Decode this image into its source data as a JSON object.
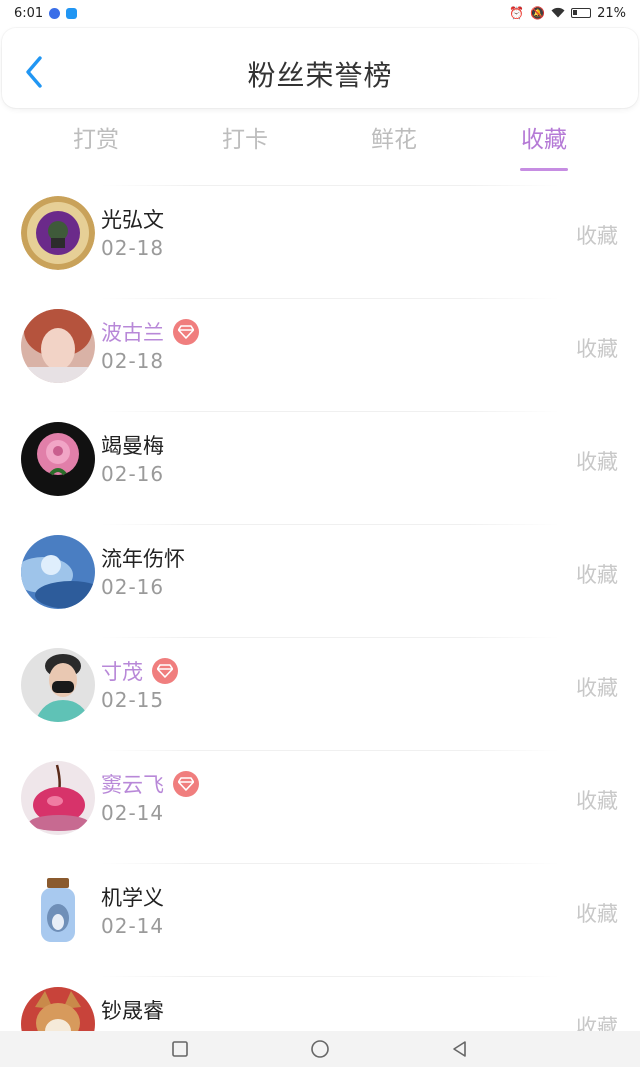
{
  "status_bar": {
    "time": "6:01",
    "battery": "21%",
    "icons": [
      "app-notification-icon",
      "cloud-icon",
      "alarm-icon",
      "mute-icon",
      "wifi-icon",
      "battery-icon"
    ]
  },
  "header": {
    "title": "粉丝荣誉榜",
    "back_icon": "chevron-left-icon"
  },
  "tabs": [
    {
      "label": "打赏",
      "active": false
    },
    {
      "label": "打卡",
      "active": false
    },
    {
      "label": "鲜花",
      "active": false
    },
    {
      "label": "收藏",
      "active": true
    }
  ],
  "accent_color": "#b57ad6",
  "vip_badge_color": "#f07e7e",
  "fans": [
    {
      "name": "光弘文",
      "date": "02-18",
      "action": "收藏",
      "vip": false,
      "avatar_style": "gold-medallion"
    },
    {
      "name": "波古兰",
      "date": "02-18",
      "action": "收藏",
      "vip": true,
      "avatar_style": "girl-portrait"
    },
    {
      "name": "竭曼梅",
      "date": "02-16",
      "action": "收藏",
      "vip": false,
      "avatar_style": "pink-rose"
    },
    {
      "name": "流年伤怀",
      "date": "02-16",
      "action": "收藏",
      "vip": false,
      "avatar_style": "blue-sky"
    },
    {
      "name": "寸茂",
      "date": "02-15",
      "action": "收藏",
      "vip": true,
      "avatar_style": "man-mask"
    },
    {
      "name": "窦云飞",
      "date": "02-14",
      "action": "收藏",
      "vip": true,
      "avatar_style": "cherry"
    },
    {
      "name": "机学义",
      "date": "02-14",
      "action": "收藏",
      "vip": false,
      "avatar_style": "bottle"
    },
    {
      "name": "钞晟睿",
      "date": "",
      "action": "收藏",
      "vip": false,
      "avatar_style": "shiba"
    }
  ],
  "nav_bar": {
    "icons": [
      "recent-apps-icon",
      "home-icon",
      "back-icon"
    ]
  }
}
